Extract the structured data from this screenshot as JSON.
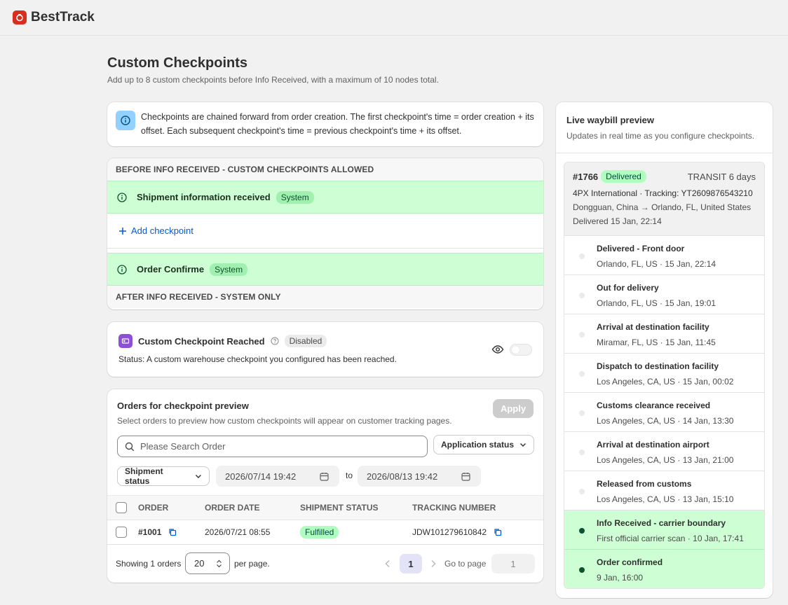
{
  "app": {
    "brand": "BestTrack"
  },
  "page": {
    "title": "Custom Checkpoints",
    "subtitle": "Add up to 8 custom checkpoints before Info Received, with a maximum of 10 nodes total."
  },
  "info_banner": {
    "text": "Checkpoints are chained forward from order creation. The first checkpoint's time = order creation + its offset. Each subsequent checkpoint's time = previous checkpoint's time + its offset."
  },
  "checkpoints": {
    "before_header": "BEFORE INFO RECEIVED - CUSTOM CHECKPOINTS ALLOWED",
    "system_1": {
      "name": "Shipment information received",
      "badge": "System"
    },
    "add_label": "Add checkpoint",
    "system_2": {
      "name": "Order Confirme",
      "badge": "System"
    },
    "after_header": "AFTER INFO RECEIVED - SYSTEM ONLY"
  },
  "reached": {
    "title": "Custom Checkpoint Reached",
    "badge": "Disabled",
    "status": "Status: A custom warehouse checkpoint you configured has been reached."
  },
  "orders": {
    "title": "Orders for checkpoint preview",
    "subtitle": "Select orders to preview how custom checkpoints will appear on customer tracking pages.",
    "apply_label": "Apply",
    "search_placeholder": "Please Search Order",
    "application_status_label": "Application status",
    "shipment_status_label": "Shipment status",
    "date_from": "2026/07/14 19:42",
    "date_to_label": "to",
    "date_to": "2026/08/13 19:42",
    "columns": {
      "order": "ORDER",
      "order_date": "ORDER DATE",
      "shipment_status": "SHIPMENT STATUS",
      "tracking_number": "TRACKING NUMBER"
    },
    "rows": [
      {
        "order": "#1001",
        "order_date": "2026/07/21 08:55",
        "shipment_status": "Fulfilled",
        "tracking_number": "JDW101279610842"
      }
    ],
    "footer": {
      "showing": "Showing 1 orders",
      "per_page_value": "20",
      "per_page_label": "per page.",
      "current_page": "1",
      "go_to_label": "Go to page",
      "go_to_value": "1"
    }
  },
  "preview": {
    "title": "Live waybill preview",
    "subtitle": "Updates in real time as you configure checkpoints.",
    "waybill": {
      "id": "#1766",
      "status_badge": "Delivered",
      "transit": "TRANSIT 6 days",
      "carrier_line": "4PX International · Tracking: YT2609876543210",
      "route": "Dongguan, China → Orlando, FL, United States",
      "delivered": "Delivered 15 Jan, 22:14"
    },
    "events": [
      {
        "title": "Delivered - Front door",
        "sub": "Orlando, FL, US · 15 Jan, 22:14",
        "active": false
      },
      {
        "title": "Out for delivery",
        "sub": "Orlando, FL, US · 15 Jan, 19:01",
        "active": false
      },
      {
        "title": "Arrival at destination facility",
        "sub": "Miramar, FL, US · 15 Jan, 11:45",
        "active": false
      },
      {
        "title": "Dispatch to destination facility",
        "sub": "Los Angeles, CA, US · 15 Jan, 00:02",
        "active": false
      },
      {
        "title": "Customs clearance received",
        "sub": "Los Angeles, CA, US · 14 Jan, 13:30",
        "active": false
      },
      {
        "title": "Arrival at destination airport",
        "sub": "Los Angeles, CA, US · 13 Jan, 21:00",
        "active": false
      },
      {
        "title": "Released from customs",
        "sub": "Los Angeles, CA, US · 13 Jan, 15:10",
        "active": false
      },
      {
        "title": "Info Received - carrier boundary",
        "sub": "First official carrier scan · 10 Jan, 17:41",
        "active": true
      },
      {
        "title": "Order confirmed",
        "sub": "9 Jan, 16:00",
        "active": true
      }
    ]
  },
  "colors": {
    "system_row": "#cdfed4",
    "success_badge": "#affebf",
    "link": "#005bd3",
    "info_icon_bg": "#91d0ff",
    "brand": "#d92d20",
    "reached_icon": "#8c4fd6"
  }
}
